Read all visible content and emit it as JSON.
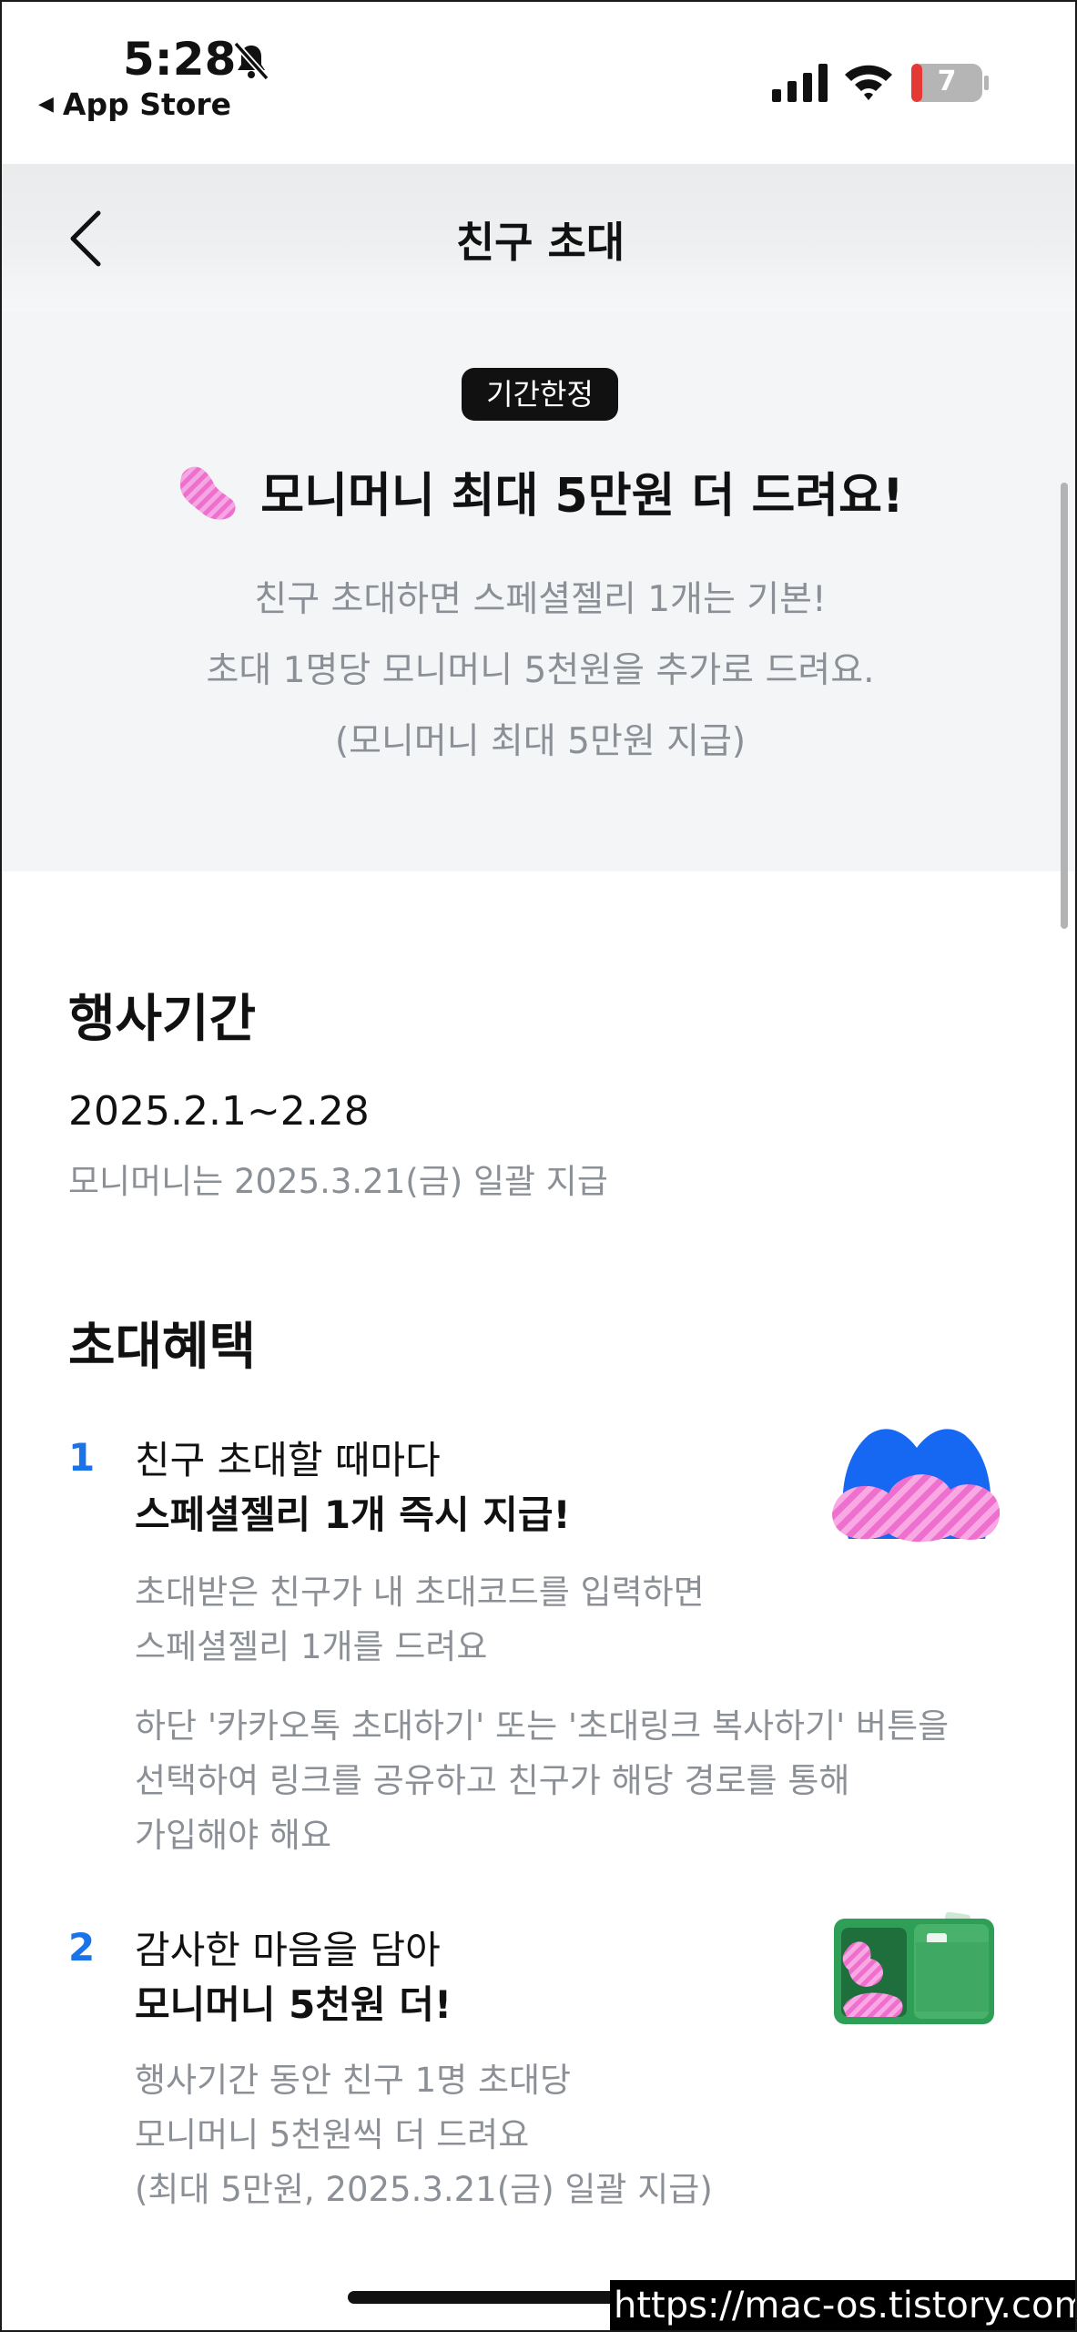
{
  "status_bar": {
    "time": "5:28",
    "back_app": "App Store",
    "battery": "7",
    "icons": [
      "bell-slash-icon",
      "signal-icon",
      "wifi-icon",
      "battery-icon"
    ]
  },
  "nav": {
    "title": "친구 초대",
    "back_icon": "chevron-left-icon"
  },
  "promo": {
    "badge": "기간한정",
    "title": "모니머니 최대 5만원 더 드려요!",
    "desc_lines": [
      "친구 초대하면 스페셜젤리 1개는 기본!",
      "초대 1명당 모니머니 5천원을 추가로 드려요.",
      "(모니머니 최대 5만원 지급)"
    ]
  },
  "period": {
    "title": "행사기간",
    "date": "2025.2.1~2.28",
    "note": "모니머니는 2025.3.21(금) 일괄 지급"
  },
  "benefits": {
    "title": "초대혜택",
    "items": [
      {
        "num": "1",
        "line1": "친구 초대할 때마다",
        "line2": "스페셜젤리 1개 즉시 지급!",
        "desc1": [
          "초대받은 친구가 내 초대코드를 입력하면",
          "스페셜젤리 1개를 드려요"
        ],
        "desc2": [
          "하단 '카카오톡 초대하기' 또는 '초대링크 복사하기' 버튼을",
          "선택하여 링크를 공유하고 친구가 해당 경로를 통해",
          "가입해야 해요"
        ]
      },
      {
        "num": "2",
        "line1": "감사한 마음을 담아",
        "line2": "모니머니 5천원 더!",
        "desc1": [
          "행사기간 동안 친구 1명 초대당",
          "모니머니 5천원씩 더 드려요",
          "(최대 5만원, 2025.3.21(금) 일괄 지급)"
        ]
      }
    ]
  },
  "watermark": "https://mac-os.tistory.com",
  "colors": {
    "accent_blue": "#1a73e8",
    "muted_text": "#8b8f96",
    "banner_bg": "#f4f5f7",
    "jelly_pink": "#f07ad2"
  }
}
